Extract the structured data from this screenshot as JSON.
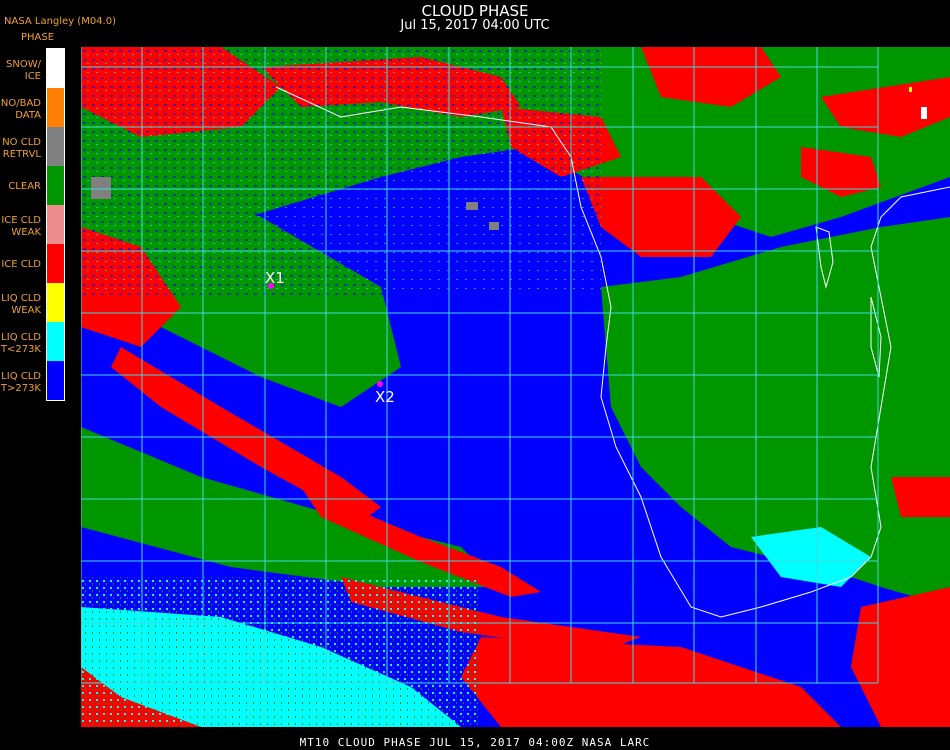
{
  "header": {
    "title": "CLOUD PHASE",
    "datetime": "Jul 15, 2017 04:00 UTC",
    "org": "NASA Langley (M04.0)"
  },
  "legend": {
    "heading": "PHASE",
    "items": [
      {
        "label_1": "SNOW/",
        "label_2": "ICE",
        "color": "#ffffff"
      },
      {
        "label_1": "NO/BAD",
        "label_2": "DATA",
        "color": "#ff8000"
      },
      {
        "label_1": "NO CLD",
        "label_2": "RETRVL",
        "color": "#808080"
      },
      {
        "label_1": "CLEAR",
        "label_2": "",
        "color": "#009600"
      },
      {
        "label_1": "ICE CLD",
        "label_2": "WEAK",
        "color": "#f08c8c"
      },
      {
        "label_1": "ICE CLD",
        "label_2": "",
        "color": "#ff0000"
      },
      {
        "label_1": "LIQ CLD",
        "label_2": "WEAK",
        "color": "#ffff00"
      },
      {
        "label_1": "LIQ CLD",
        "label_2": "T<273K",
        "color": "#00ffff"
      },
      {
        "label_1": "LIQ CLD",
        "label_2": "T>273K",
        "color": "#0000ff"
      }
    ]
  },
  "markers": [
    {
      "label": "X1",
      "color": "#ff00ff"
    },
    {
      "label": "X2",
      "color": "#ff00ff"
    }
  ],
  "grid_color": "#3cdcdc",
  "coast_color": "#ffffff",
  "footer": "MT10  CLOUD PHASE   JUL 15, 2017 04:00Z   NASA LARC"
}
